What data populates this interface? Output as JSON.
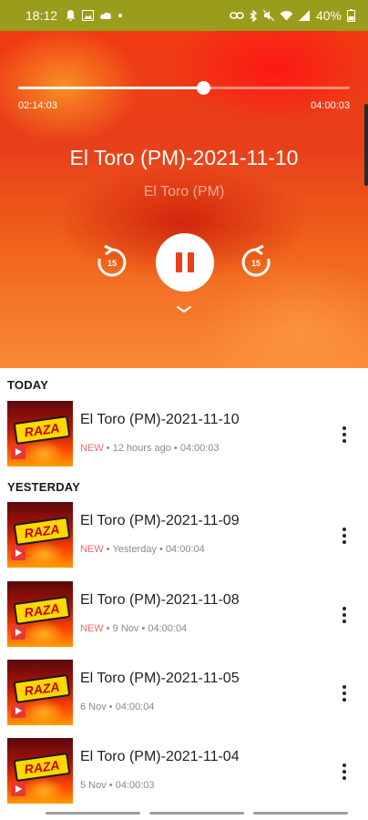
{
  "status_bar": {
    "time": "18:12",
    "left_icons": [
      "notification-bell-icon",
      "image-icon",
      "cloud-icon",
      "dot-icon"
    ],
    "right_icons": [
      "link-icon",
      "bluetooth-icon",
      "mute-icon",
      "wifi-icon",
      "signal-icon"
    ],
    "battery": "40%",
    "background": "#9a9c1c"
  },
  "player": {
    "elapsed": "02:14:03",
    "total": "04:00:03",
    "progress": 0.5583,
    "title": "El Toro (PM)-2021-11-10",
    "artist": "El Toro (PM)",
    "rewind_label": "15",
    "forward_label": "15",
    "state": "playing"
  },
  "sections": {
    "today": "TODAY",
    "yesterday": "YESTERDAY"
  },
  "episodes": [
    {
      "title": "El Toro (PM)-2021-11-10",
      "badge": "NEW",
      "when": "12 hours ago",
      "duration": "04:00:03"
    },
    {
      "title": "El Toro (PM)-2021-11-09",
      "badge": "NEW",
      "when": "Yesterday",
      "duration": "04:00:04"
    },
    {
      "title": "El Toro (PM)-2021-11-08",
      "badge": "NEW",
      "when": "9 Nov",
      "duration": "04:00:04"
    },
    {
      "title": "El Toro (PM)-2021-11-05",
      "badge": "",
      "when": "6 Nov",
      "duration": "04:00:04"
    },
    {
      "title": "El Toro (PM)-2021-11-04",
      "badge": "",
      "when": "5 Nov",
      "duration": "04:00:03"
    }
  ],
  "thumbnail_logo_text": "RAZA",
  "colors": {
    "accent_new": "#ef6a6a",
    "player_orange": "#f0641a",
    "player_red": "#f03a12"
  }
}
